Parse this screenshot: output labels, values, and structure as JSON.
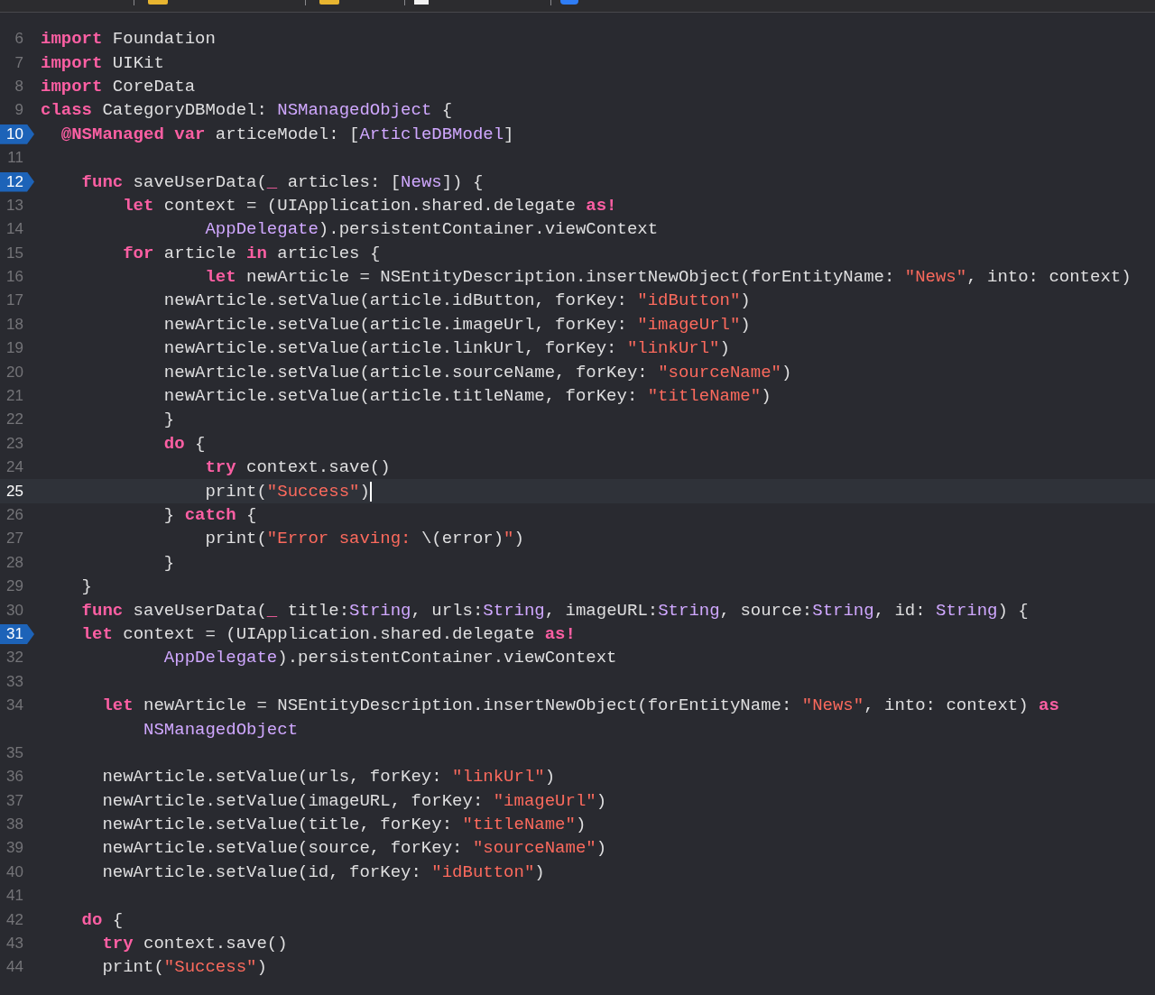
{
  "editor": {
    "lines": [
      {
        "number": "6",
        "breakpoint": false,
        "current": false,
        "tokens": [
          {
            "kind": "kw",
            "text": "import"
          },
          {
            "kind": "plain",
            "text": " Foundation"
          }
        ]
      },
      {
        "number": "7",
        "breakpoint": false,
        "current": false,
        "tokens": [
          {
            "kind": "kw",
            "text": "import"
          },
          {
            "kind": "plain",
            "text": " UIKit"
          }
        ]
      },
      {
        "number": "8",
        "breakpoint": false,
        "current": false,
        "tokens": [
          {
            "kind": "kw",
            "text": "import"
          },
          {
            "kind": "plain",
            "text": " CoreData"
          }
        ]
      },
      {
        "number": "9",
        "breakpoint": false,
        "current": false,
        "tokens": [
          {
            "kind": "kw",
            "text": "class"
          },
          {
            "kind": "plain",
            "text": " CategoryDBModel: "
          },
          {
            "kind": "type",
            "text": "NSManagedObject"
          },
          {
            "kind": "plain",
            "text": " {"
          }
        ]
      },
      {
        "number": "10",
        "breakpoint": true,
        "current": false,
        "tokens": [
          {
            "kind": "kw",
            "text": "  @NSManaged"
          },
          {
            "kind": "kw",
            "text": " var"
          },
          {
            "kind": "plain",
            "text": " articeModel: ["
          },
          {
            "kind": "type",
            "text": "ArticleDBModel"
          },
          {
            "kind": "plain",
            "text": "]"
          }
        ]
      },
      {
        "number": "11",
        "breakpoint": false,
        "current": false
      },
      {
        "number": "12",
        "breakpoint": true,
        "current": false,
        "tokens": [
          {
            "kind": "kw",
            "text": "    func"
          },
          {
            "kind": "plain",
            "text": " saveUserData("
          },
          {
            "kind": "kw",
            "text": "_"
          },
          {
            "kind": "plain",
            "text": " articles: ["
          },
          {
            "kind": "type",
            "text": "News"
          },
          {
            "kind": "plain",
            "text": "]) {"
          }
        ]
      },
      {
        "number": "13",
        "breakpoint": false,
        "current": false,
        "tokens": [
          {
            "kind": "kw",
            "text": "        let"
          },
          {
            "kind": "plain",
            "text": " context = (UIApplication.shared.delegate "
          },
          {
            "kind": "kw",
            "text": "as!"
          }
        ]
      },
      {
        "number": "14",
        "breakpoint": false,
        "current": false,
        "tokens": [
          {
            "kind": "type",
            "text": "                AppDelegate"
          },
          {
            "kind": "plain",
            "text": ").persistentContainer.viewContext"
          }
        ]
      },
      {
        "number": "15",
        "breakpoint": false,
        "current": false,
        "tokens": [
          {
            "kind": "kw",
            "text": "        for"
          },
          {
            "kind": "plain",
            "text": " article "
          },
          {
            "kind": "kw",
            "text": "in"
          },
          {
            "kind": "plain",
            "text": " articles {"
          }
        ]
      },
      {
        "number": "16",
        "breakpoint": false,
        "current": false,
        "tokens": [
          {
            "kind": "kw",
            "text": "                let"
          },
          {
            "kind": "plain",
            "text": " newArticle = NSEntityDescription.insertNewObject(forEntityName: "
          },
          {
            "kind": "str",
            "text": "\"News\""
          },
          {
            "kind": "plain",
            "text": ", into: context)"
          }
        ]
      },
      {
        "number": "17",
        "breakpoint": false,
        "current": false,
        "tokens": [
          {
            "kind": "plain",
            "text": "            newArticle.setValue(article.idButton, forKey: "
          },
          {
            "kind": "str",
            "text": "\"idButton\""
          },
          {
            "kind": "plain",
            "text": ")"
          }
        ]
      },
      {
        "number": "18",
        "breakpoint": false,
        "current": false,
        "tokens": [
          {
            "kind": "plain",
            "text": "            newArticle.setValue(article.imageUrl, forKey: "
          },
          {
            "kind": "str",
            "text": "\"imageUrl\""
          },
          {
            "kind": "plain",
            "text": ")"
          }
        ]
      },
      {
        "number": "19",
        "breakpoint": false,
        "current": false,
        "tokens": [
          {
            "kind": "plain",
            "text": "            newArticle.setValue(article.linkUrl, forKey: "
          },
          {
            "kind": "str",
            "text": "\"linkUrl\""
          },
          {
            "kind": "plain",
            "text": ")"
          }
        ]
      },
      {
        "number": "20",
        "breakpoint": false,
        "current": false,
        "tokens": [
          {
            "kind": "plain",
            "text": "            newArticle.setValue(article.sourceName, forKey: "
          },
          {
            "kind": "str",
            "text": "\"sourceName\""
          },
          {
            "kind": "plain",
            "text": ")"
          }
        ]
      },
      {
        "number": "21",
        "breakpoint": false,
        "current": false,
        "tokens": [
          {
            "kind": "plain",
            "text": "            newArticle.setValue(article.titleName, forKey: "
          },
          {
            "kind": "str",
            "text": "\"titleName\""
          },
          {
            "kind": "plain",
            "text": ")"
          }
        ]
      },
      {
        "number": "22",
        "breakpoint": false,
        "current": false,
        "tokens": [
          {
            "kind": "plain",
            "text": "            }"
          }
        ]
      },
      {
        "number": "23",
        "breakpoint": false,
        "current": false,
        "tokens": [
          {
            "kind": "kw",
            "text": "            do"
          },
          {
            "kind": "plain",
            "text": " {"
          }
        ]
      },
      {
        "number": "24",
        "breakpoint": false,
        "current": false,
        "tokens": [
          {
            "kind": "kw",
            "text": "                try"
          },
          {
            "kind": "plain",
            "text": " context.save()"
          }
        ]
      },
      {
        "number": "25",
        "breakpoint": false,
        "current": true,
        "tokens": [
          {
            "kind": "plain",
            "text": "                print("
          },
          {
            "kind": "str",
            "text": "\"Success\""
          },
          {
            "kind": "plain",
            "text": ")"
          }
        ]
      },
      {
        "number": "26",
        "breakpoint": false,
        "current": false,
        "tokens": [
          {
            "kind": "plain",
            "text": "            } "
          },
          {
            "kind": "kw",
            "text": "catch"
          },
          {
            "kind": "plain",
            "text": " {"
          }
        ]
      },
      {
        "number": "27",
        "breakpoint": false,
        "current": false,
        "tokens": [
          {
            "kind": "plain",
            "text": "                print("
          },
          {
            "kind": "str",
            "text": "\"Error saving: "
          },
          {
            "kind": "plain",
            "text": "\\(error)"
          },
          {
            "kind": "str",
            "text": "\""
          },
          {
            "kind": "plain",
            "text": ")"
          }
        ]
      },
      {
        "number": "28",
        "breakpoint": false,
        "current": false,
        "tokens": [
          {
            "kind": "plain",
            "text": "            }"
          }
        ]
      },
      {
        "number": "29",
        "breakpoint": false,
        "current": false,
        "tokens": [
          {
            "kind": "plain",
            "text": "    }"
          }
        ]
      },
      {
        "number": "30",
        "breakpoint": false,
        "current": false,
        "tokens": [
          {
            "kind": "kw",
            "text": "    func"
          },
          {
            "kind": "plain",
            "text": " saveUserData("
          },
          {
            "kind": "kw",
            "text": "_"
          },
          {
            "kind": "plain",
            "text": " title:"
          },
          {
            "kind": "type",
            "text": "String"
          },
          {
            "kind": "plain",
            "text": ", urls:"
          },
          {
            "kind": "type",
            "text": "String"
          },
          {
            "kind": "plain",
            "text": ", imageURL:"
          },
          {
            "kind": "type",
            "text": "String"
          },
          {
            "kind": "plain",
            "text": ", source:"
          },
          {
            "kind": "type",
            "text": "String"
          },
          {
            "kind": "plain",
            "text": ", id: "
          },
          {
            "kind": "type",
            "text": "String"
          },
          {
            "kind": "plain",
            "text": ") {"
          }
        ]
      },
      {
        "number": "31",
        "breakpoint": true,
        "current": false,
        "tokens": [
          {
            "kind": "kw",
            "text": "    let"
          },
          {
            "kind": "plain",
            "text": " context = (UIApplication.shared.delegate "
          },
          {
            "kind": "kw",
            "text": "as!"
          }
        ]
      },
      {
        "number": "32",
        "breakpoint": false,
        "current": false,
        "tokens": [
          {
            "kind": "type",
            "text": "            AppDelegate"
          },
          {
            "kind": "plain",
            "text": ").persistentContainer.viewContext"
          }
        ]
      },
      {
        "number": "33",
        "breakpoint": false,
        "current": false
      },
      {
        "number": "34",
        "breakpoint": false,
        "current": false,
        "tokens": [
          {
            "kind": "kw",
            "text": "      let"
          },
          {
            "kind": "plain",
            "text": " newArticle = NSEntityDescription.insertNewObject(forEntityName: "
          },
          {
            "kind": "str",
            "text": "\"News\""
          },
          {
            "kind": "plain",
            "text": ", into: context) "
          },
          {
            "kind": "kw",
            "text": "as"
          }
        ],
        "continuation": [
          {
            "kind": "type",
            "text": "          NSManagedObject"
          }
        ]
      },
      {
        "number": "35",
        "breakpoint": false,
        "current": false
      },
      {
        "number": "36",
        "breakpoint": false,
        "current": false,
        "tokens": [
          {
            "kind": "plain",
            "text": "      newArticle.setValue(urls, forKey: "
          },
          {
            "kind": "str",
            "text": "\"linkUrl\""
          },
          {
            "kind": "plain",
            "text": ")"
          }
        ]
      },
      {
        "number": "37",
        "breakpoint": false,
        "current": false,
        "tokens": [
          {
            "kind": "plain",
            "text": "      newArticle.setValue(imageURL, forKey: "
          },
          {
            "kind": "str",
            "text": "\"imageUrl\""
          },
          {
            "kind": "plain",
            "text": ")"
          }
        ]
      },
      {
        "number": "38",
        "breakpoint": false,
        "current": false,
        "tokens": [
          {
            "kind": "plain",
            "text": "      newArticle.setValue(title, forKey: "
          },
          {
            "kind": "str",
            "text": "\"titleName\""
          },
          {
            "kind": "plain",
            "text": ")"
          }
        ]
      },
      {
        "number": "39",
        "breakpoint": false,
        "current": false,
        "tokens": [
          {
            "kind": "plain",
            "text": "      newArticle.setValue(source, forKey: "
          },
          {
            "kind": "str",
            "text": "\"sourceName\""
          },
          {
            "kind": "plain",
            "text": ")"
          }
        ]
      },
      {
        "number": "40",
        "breakpoint": false,
        "current": false,
        "tokens": [
          {
            "kind": "plain",
            "text": "      newArticle.setValue(id, forKey: "
          },
          {
            "kind": "str",
            "text": "\"idButton\""
          },
          {
            "kind": "plain",
            "text": ")"
          }
        ]
      },
      {
        "number": "41",
        "breakpoint": false,
        "current": false
      },
      {
        "number": "42",
        "breakpoint": false,
        "current": false,
        "tokens": [
          {
            "kind": "kw",
            "text": "    do"
          },
          {
            "kind": "plain",
            "text": " {"
          }
        ]
      },
      {
        "number": "43",
        "breakpoint": false,
        "current": false,
        "tokens": [
          {
            "kind": "kw",
            "text": "      try"
          },
          {
            "kind": "plain",
            "text": " context.save()"
          }
        ]
      },
      {
        "number": "44",
        "breakpoint": false,
        "current": false,
        "tokens": [
          {
            "kind": "plain",
            "text": "      print("
          },
          {
            "kind": "str",
            "text": "\"Success\""
          },
          {
            "kind": "plain",
            "text": ")"
          }
        ]
      }
    ]
  }
}
